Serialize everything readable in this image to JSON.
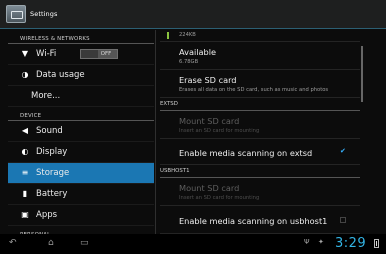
{
  "window": {
    "title": "Settings",
    "app_icon": "settings-app-icon"
  },
  "sidebar": {
    "sections": [
      {
        "header": "WIRELESS & NETWORKS",
        "items": [
          {
            "label": "Wi-Fi",
            "icon": "wifi-icon",
            "toggle": "OFF"
          },
          {
            "label": "Data usage",
            "icon": "data-usage-icon"
          },
          {
            "label": "More...",
            "icon": ""
          }
        ]
      },
      {
        "header": "DEVICE",
        "items": [
          {
            "label": "Sound",
            "icon": "speaker-icon"
          },
          {
            "label": "Display",
            "icon": "display-icon"
          },
          {
            "label": "Storage",
            "icon": "storage-icon",
            "selected": true
          },
          {
            "label": "Battery",
            "icon": "battery-icon"
          },
          {
            "label": "Apps",
            "icon": "apps-icon"
          }
        ]
      },
      {
        "header": "PERSONAL",
        "items": []
      }
    ]
  },
  "storage": {
    "top_value": "224KB",
    "available": {
      "title": "Available",
      "summary": "6.78GB"
    },
    "erase": {
      "title": "Erase SD card",
      "summary": "Erases all data on the SD card, such as music and photos"
    },
    "extsd": {
      "header": "EXTSD",
      "mount": {
        "title": "Mount SD card",
        "summary": "Insert an SD card for mounting"
      },
      "scan": {
        "title": "Enable media scanning on extsd",
        "checked": true
      }
    },
    "usbhost1": {
      "header": "USBHOST1",
      "mount": {
        "title": "Mount SD card",
        "summary": "Insert an SD card for mounting"
      },
      "scan": {
        "title": "Enable media scanning on usbhost1",
        "checked": false
      }
    }
  },
  "navbar": {
    "buttons": [
      "back-icon",
      "home-icon",
      "recent-apps-icon"
    ],
    "status_icons": [
      "usb-icon",
      "usb-debugging-icon"
    ],
    "clock": "3:29",
    "accent_color": "#33b5e5"
  }
}
